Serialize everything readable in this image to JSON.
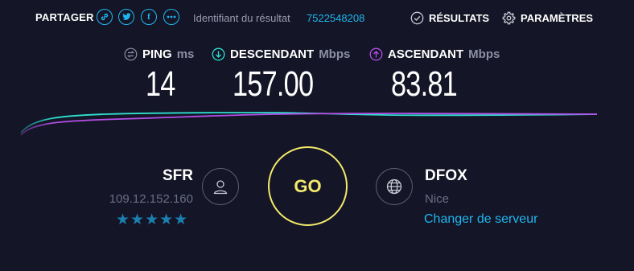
{
  "share": {
    "label": "PARTAGER",
    "icons": [
      "link-icon",
      "twitter-icon",
      "facebook-icon",
      "more-icon"
    ]
  },
  "result": {
    "label": "Identifiant du résultat",
    "id": "7522548208"
  },
  "nav": {
    "results_label": "RÉSULTATS",
    "settings_label": "PARAMÈTRES"
  },
  "metrics": {
    "ping": {
      "label": "PING",
      "unit": "ms",
      "value": "14"
    },
    "download": {
      "label": "DESCENDANT",
      "unit": "Mbps",
      "value": "157.00"
    },
    "upload": {
      "label": "ASCENDANT",
      "unit": "Mbps",
      "value": "83.81"
    }
  },
  "isp": {
    "name": "SFR",
    "ip": "109.12.152.160",
    "stars": "★★★★★",
    "rating": 5
  },
  "go_label": "GO",
  "server": {
    "name": "DFOX",
    "city": "Nice",
    "change_label": "Changer de serveur"
  },
  "colors": {
    "background": "#141526",
    "accent": "#1fb7f0",
    "download": "#2fe0d0",
    "upload": "#b34fe8",
    "go": "#f3ea6c"
  }
}
